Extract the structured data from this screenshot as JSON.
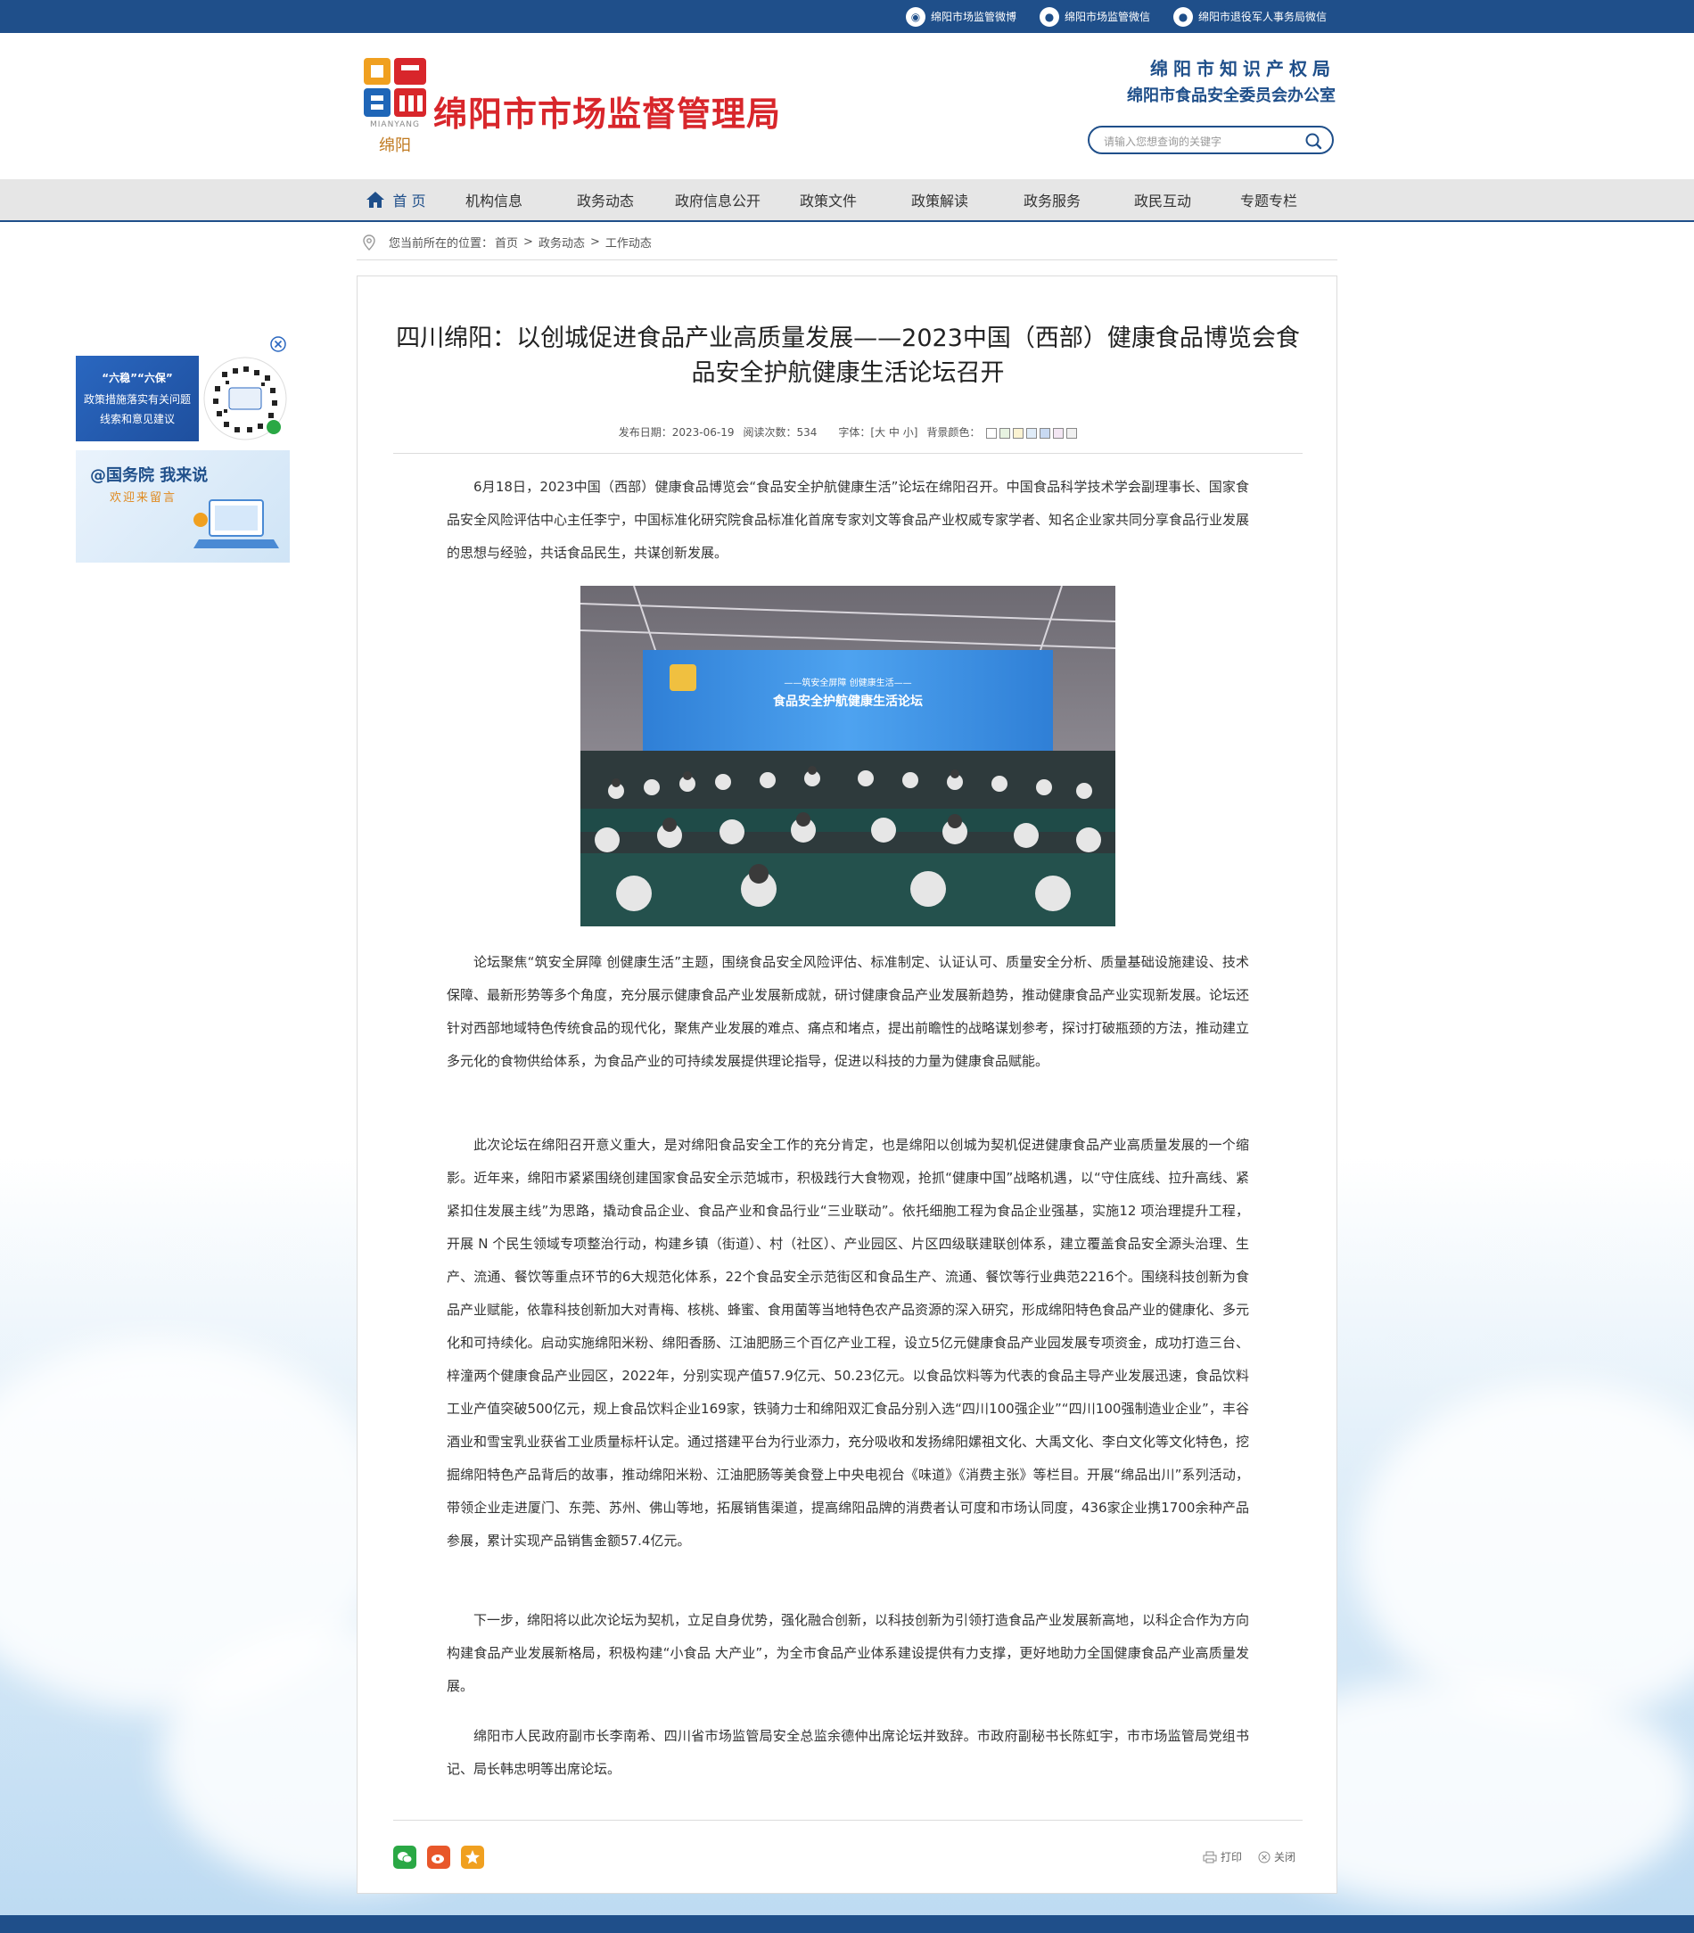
{
  "topbar": {
    "links": [
      {
        "label": "绵阳市场监管微博",
        "icon": "weibo-icon"
      },
      {
        "label": "绵阳市场监管微信",
        "icon": "wechat-icon"
      },
      {
        "label": "绵阳市退役军人事务局微信",
        "icon": "wechat-icon"
      }
    ]
  },
  "header": {
    "logo_subtext": "MIANYANG",
    "logo_city": "绵阳",
    "site_title": "绵阳市市场监督管理局",
    "org_line1": "绵阳市知识产权局",
    "org_line2": "绵阳市食品安全委员会办公室",
    "search_placeholder": "请输入您想查询的关键字"
  },
  "nav": {
    "items": [
      "首 页",
      "机构信息",
      "政务动态",
      "政府信息公开",
      "政策文件",
      "政策解读",
      "政务服务",
      "政民互动",
      "专题专栏"
    ]
  },
  "breadcrumb": {
    "prefix": "您当前所在的位置：",
    "items": [
      "首页",
      "政务动态",
      "工作动态"
    ],
    "sep": ">"
  },
  "ads": {
    "ad1_line1": "“六稳”“六保”",
    "ad1_line2": "政策措施落实有关问题",
    "ad1_line3": "线索和意见建议",
    "ad2_title": "@国务院 我来说",
    "ad2_sub": "欢迎来留言"
  },
  "article": {
    "title": "四川绵阳：以创城促进食品产业高质量发展——2023中国（西部）健康食品博览会食品安全护航健康生活论坛召开",
    "meta": {
      "date_label": "发布日期：",
      "date": "2023-06-19",
      "views_label": "阅读次数：",
      "views": "534",
      "font_label": "字体：",
      "font_sizes": "[大 中 小]",
      "bg_label": "背景颜色："
    },
    "bg_colors": [
      "#ffffff",
      "#e7f3e1",
      "#fbf3d2",
      "#e0ecf8",
      "#c8d9f2",
      "#f3e6f3",
      "#f0f0f0"
    ],
    "paragraphs": [
      "6月18日，2023中国（西部）健康食品博览会“食品安全护航健康生活”论坛在绵阳召开。中国食品科学技术学会副理事长、国家食品安全风险评估中心主任李宁，中国标准化研究院食品标准化首席专家刘文等食品产业权威专家学者、知名企业家共同分享食品行业发展的思想与经验，共话食品民生，共谋创新发展。",
      "论坛聚焦“筑安全屏障 创健康生活”主题，围绕食品安全风险评估、标准制定、认证认可、质量安全分析、质量基础设施建设、技术保障、最新形势等多个角度，充分展示健康食品产业发展新成就，研讨健康食品产业发展新趋势，推动健康食品产业实现新发展。论坛还针对西部地域特色传统食品的现代化，聚焦产业发展的难点、痛点和堵点，提出前瞻性的战略谋划参考，探讨打破瓶颈的方法，推动建立多元化的食物供给体系，为食品产业的可持续发展提供理论指导，促进以科技的力量为健康食品赋能。",
      "此次论坛在绵阳召开意义重大，是对绵阳食品安全工作的充分肯定，也是绵阳以创城为契机促进健康食品产业高质量发展的一个缩影。近年来，绵阳市紧紧围绕创建国家食品安全示范城市，积极践行大食物观，抢抓“健康中国”战略机遇，以“守住底线、拉升高线、紧紧扣住发展主线”为思路，撬动食品企业、食品产业和食品行业“三业联动”。依托细胞工程为食品企业强基，实施12 项治理提升工程，开展 N 个民生领域专项整治行动，构建乡镇（街道）、村（社区）、产业园区、片区四级联建联创体系，建立覆盖食品安全源头治理、生产、流通、餐饮等重点环节的6大规范化体系，22个食品安全示范街区和食品生产、流通、餐饮等行业典范2216个。围绕科技创新为食品产业赋能，依靠科技创新加大对青梅、核桃、蜂蜜、食用菌等当地特色农产品资源的深入研究，形成绵阳特色食品产业的健康化、多元化和可持续化。启动实施绵阳米粉、绵阳香肠、江油肥肠三个百亿产业工程，设立5亿元健康食品产业园发展专项资金，成功打造三台、梓潼两个健康食品产业园区，2022年，分别实现产值57.9亿元、50.23亿元。以食品饮料等为代表的食品主导产业发展迅速，食品饮料工业产值突破500亿元，规上食品饮料企业169家，铁骑力士和绵阳双汇食品分别入选“四川100强企业”“四川100强制造业企业”，丰谷酒业和雪宝乳业获省工业质量标杆认定。通过搭建平台为行业添力，充分吸收和发扬绵阳嫘祖文化、大禹文化、李白文化等文化特色，挖掘绵阳特色产品背后的故事，推动绵阳米粉、江油肥肠等美食登上中央电视台《味道》《消费主张》等栏目。开展“绵品出川”系列活动，带领企业走进厦门、东莞、苏州、佛山等地，拓展销售渠道，提高绵阳品牌的消费者认可度和市场认同度，436家企业携1700余种产品参展，累计实现产品销售金额57.4亿元。",
      "下一步，绵阳将以此次论坛为契机，立足自身优势，强化融合创新，以科技创新为引领打造食品产业发展新高地，以科企合作为方向构建食品产业发展新格局，积极构建“小食品 大产业”，为全市食品产业体系建设提供有力支撑，更好地助力全国健康食品产业高质量发展。",
      "绵阳市人民政府副市长李南希、四川省市场监管局安全总监余德仲出席论坛并致辞。市政府副秘书长陈虹宇，市市场监管局党组书记、局长韩忠明等出席论坛。"
    ],
    "photo": {
      "screen_line1": "——筑安全屏障 创健康生活——",
      "screen_line2": "食品安全护航健康生活论坛"
    }
  },
  "tools": {
    "print": "打印",
    "close": "关闭"
  },
  "colors": {
    "brand_blue": "#1f4f8a",
    "title_red": "#d8262b"
  }
}
